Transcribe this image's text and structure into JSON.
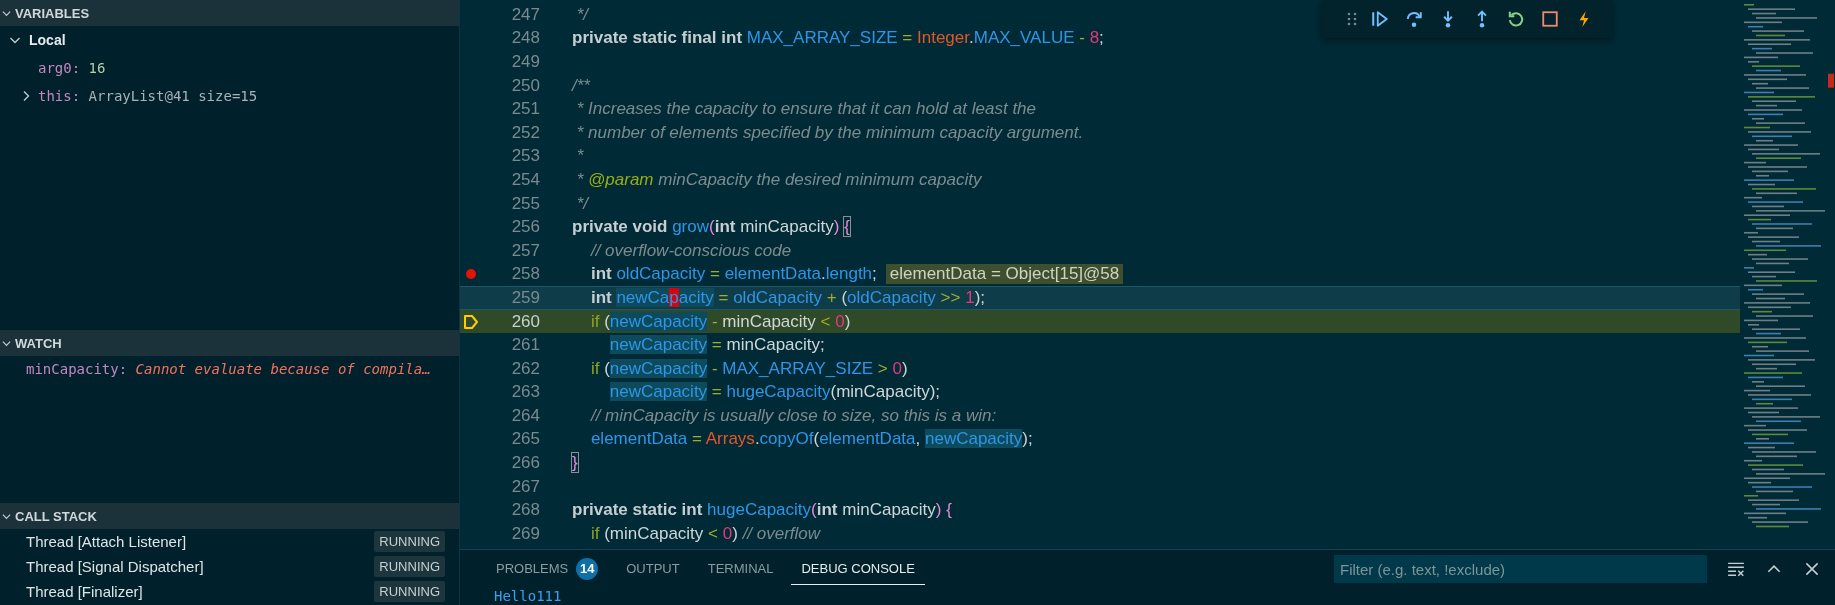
{
  "sidebar": {
    "variables": {
      "title": "VARIABLES",
      "expanded": true,
      "scopes": [
        {
          "name": "Local",
          "expanded": true,
          "children": [
            {
              "name": "arg0:",
              "value": "16",
              "kind": "number"
            },
            {
              "name": "this:",
              "value": "ArrayList@41 size=15",
              "kind": "object",
              "expanded": false
            }
          ]
        }
      ]
    },
    "watch": {
      "title": "WATCH",
      "expanded": true,
      "items": [
        {
          "name": "minCapacity:",
          "value": "Cannot evaluate because of compila…",
          "kind": "error"
        }
      ]
    },
    "call_stack": {
      "title": "CALL STACK",
      "expanded": true,
      "threads": [
        {
          "name": "Thread [Attach Listener]",
          "status": "RUNNING"
        },
        {
          "name": "Thread [Signal Dispatcher]",
          "status": "RUNNING"
        },
        {
          "name": "Thread [Finalizer]",
          "status": "RUNNING"
        }
      ]
    }
  },
  "editor": {
    "lines": [
      {
        "number": "247",
        "breakpoint": false,
        "paused": false,
        "focused": false,
        "tokens": [
          {
            "text": " */",
            "kind": "cm"
          }
        ]
      },
      {
        "number": "248",
        "breakpoint": false,
        "paused": false,
        "focused": false,
        "tokens": [
          {
            "text": "private static final int ",
            "kind": "kw"
          },
          {
            "text": "MAX_ARRAY_SIZE",
            "kind": "var"
          },
          {
            "text": " = ",
            "kind": "op"
          },
          {
            "text": "Integer",
            "kind": "cls"
          },
          {
            "text": ".",
            "kind": "plain"
          },
          {
            "text": "MAX_VALUE",
            "kind": "var"
          },
          {
            "text": " - ",
            "kind": "op"
          },
          {
            "text": "8",
            "kind": "num"
          },
          {
            "text": ";",
            "kind": "plain"
          }
        ]
      },
      {
        "number": "249",
        "breakpoint": false,
        "paused": false,
        "focused": false
      },
      {
        "number": "250",
        "breakpoint": false,
        "paused": false,
        "focused": false,
        "tokens": [
          {
            "text": "/**",
            "kind": "cm"
          }
        ]
      },
      {
        "number": "251",
        "breakpoint": false,
        "paused": false,
        "focused": false,
        "tokens": [
          {
            "text": " * Increases the capacity to ensure that it can hold at least the",
            "kind": "cm"
          }
        ]
      },
      {
        "number": "252",
        "breakpoint": false,
        "paused": false,
        "focused": false,
        "tokens": [
          {
            "text": " * number of elements specified by the minimum capacity argument.",
            "kind": "cm"
          }
        ]
      },
      {
        "number": "253",
        "breakpoint": false,
        "paused": false,
        "focused": false,
        "tokens": [
          {
            "text": " *",
            "kind": "cm"
          }
        ]
      },
      {
        "number": "254",
        "breakpoint": false,
        "paused": false,
        "focused": false,
        "tokens": [
          {
            "text": " * ",
            "kind": "cm"
          },
          {
            "text": "@param",
            "kind": "doctag"
          },
          {
            "text": " minCapacity the desired minimum capacity",
            "kind": "cm"
          }
        ]
      },
      {
        "number": "255",
        "breakpoint": false,
        "paused": false,
        "focused": false,
        "tokens": [
          {
            "text": " */",
            "kind": "cm"
          }
        ]
      },
      {
        "number": "256",
        "breakpoint": false,
        "paused": false,
        "focused": false,
        "tokens": [
          {
            "text": "private void ",
            "kind": "kw"
          },
          {
            "text": "grow",
            "kind": "fn"
          },
          {
            "text": "(",
            "kind": "bracket"
          },
          {
            "text": "int",
            "kind": "kw"
          },
          {
            "text": " minCapacity",
            "kind": "plain"
          },
          {
            "text": ") ",
            "kind": "bracket"
          },
          {
            "text": "{",
            "kind": "match"
          }
        ]
      },
      {
        "number": "257",
        "breakpoint": false,
        "paused": false,
        "focused": false,
        "tokens": [
          {
            "text": "    // overflow-conscious code",
            "kind": "cm"
          }
        ]
      },
      {
        "number": "258",
        "breakpoint": true,
        "paused": false,
        "focused": false,
        "inline_value": "elementData = Object[15]@58",
        "tokens": [
          {
            "text": "    int ",
            "kind": "kw"
          },
          {
            "text": "oldCapacity",
            "kind": "var"
          },
          {
            "text": " = ",
            "kind": "op"
          },
          {
            "text": "elementData",
            "kind": "var"
          },
          {
            "text": ".",
            "kind": "plain"
          },
          {
            "text": "length",
            "kind": "var"
          },
          {
            "text": ";",
            "kind": "plain"
          }
        ]
      },
      {
        "number": "259",
        "breakpoint": false,
        "paused": false,
        "focused": true,
        "tokens": [
          {
            "text": "    int ",
            "kind": "kw"
          },
          {
            "text": "newCa",
            "kind": "var-hl"
          },
          {
            "text": "p",
            "kind": "caret"
          },
          {
            "text": "acity",
            "kind": "var-hl"
          },
          {
            "text": " = ",
            "kind": "op"
          },
          {
            "text": "oldCapacity",
            "kind": "var"
          },
          {
            "text": " + ",
            "kind": "op"
          },
          {
            "text": "(",
            "kind": "plain"
          },
          {
            "text": "oldCapacity",
            "kind": "var"
          },
          {
            "text": " >> ",
            "kind": "op"
          },
          {
            "text": "1",
            "kind": "num"
          },
          {
            "text": ");",
            "kind": "plain"
          }
        ]
      },
      {
        "number": "260",
        "breakpoint": false,
        "paused": true,
        "focused": false,
        "tokens": [
          {
            "text": "    if",
            "kind": "ctrl"
          },
          {
            "text": " (",
            "kind": "plain"
          },
          {
            "text": "newCapacity",
            "kind": "var-hl"
          },
          {
            "text": " - ",
            "kind": "op"
          },
          {
            "text": "minCapacity",
            "kind": "plain"
          },
          {
            "text": " < ",
            "kind": "op"
          },
          {
            "text": "0",
            "kind": "num"
          },
          {
            "text": ")",
            "kind": "plain"
          }
        ]
      },
      {
        "number": "261",
        "breakpoint": false,
        "paused": false,
        "focused": false,
        "tokens": [
          {
            "text": "        newCapacity",
            "kind": "var-hl"
          },
          {
            "text": " = ",
            "kind": "op"
          },
          {
            "text": "minCapacity;",
            "kind": "plain"
          }
        ]
      },
      {
        "number": "262",
        "breakpoint": false,
        "paused": false,
        "focused": false,
        "tokens": [
          {
            "text": "    if",
            "kind": "ctrl"
          },
          {
            "text": " (",
            "kind": "plain"
          },
          {
            "text": "newCapacity",
            "kind": "var-hl"
          },
          {
            "text": " - ",
            "kind": "op"
          },
          {
            "text": "MAX_ARRAY_SIZE",
            "kind": "var"
          },
          {
            "text": " > ",
            "kind": "op"
          },
          {
            "text": "0",
            "kind": "num"
          },
          {
            "text": ")",
            "kind": "plain"
          }
        ]
      },
      {
        "number": "263",
        "breakpoint": false,
        "paused": false,
        "focused": false,
        "tokens": [
          {
            "text": "        newCapacity",
            "kind": "var-hl"
          },
          {
            "text": " = ",
            "kind": "op"
          },
          {
            "text": "hugeCapacity",
            "kind": "fn"
          },
          {
            "text": "(minCapacity);",
            "kind": "plain"
          }
        ]
      },
      {
        "number": "264",
        "breakpoint": false,
        "paused": false,
        "focused": false,
        "tokens": [
          {
            "text": "    // minCapacity is usually close to size, so this is a win:",
            "kind": "cm"
          }
        ]
      },
      {
        "number": "265",
        "breakpoint": false,
        "paused": false,
        "focused": false,
        "tokens": [
          {
            "text": "    elementData",
            "kind": "var"
          },
          {
            "text": " = ",
            "kind": "op"
          },
          {
            "text": "Arrays",
            "kind": "cls"
          },
          {
            "text": ".",
            "kind": "plain"
          },
          {
            "text": "copyOf",
            "kind": "fn"
          },
          {
            "text": "(",
            "kind": "plain"
          },
          {
            "text": "elementData",
            "kind": "var"
          },
          {
            "text": ", ",
            "kind": "plain"
          },
          {
            "text": "newCapacity",
            "kind": "var-hl"
          },
          {
            "text": ");",
            "kind": "plain"
          }
        ]
      },
      {
        "number": "266",
        "breakpoint": false,
        "paused": false,
        "focused": false,
        "tokens": [
          {
            "text": "}",
            "kind": "match"
          }
        ]
      },
      {
        "number": "267",
        "breakpoint": false,
        "paused": false,
        "focused": false
      },
      {
        "number": "268",
        "breakpoint": false,
        "paused": false,
        "focused": false,
        "tokens": [
          {
            "text": "private static int ",
            "kind": "kw"
          },
          {
            "text": "hugeCapacity",
            "kind": "fn"
          },
          {
            "text": "(",
            "kind": "bracket"
          },
          {
            "text": "int",
            "kind": "kw"
          },
          {
            "text": " minCapacity",
            "kind": "plain"
          },
          {
            "text": ")",
            "kind": "bracket"
          },
          {
            "text": " {",
            "kind": "bracket"
          }
        ]
      },
      {
        "number": "269",
        "breakpoint": false,
        "paused": false,
        "focused": false,
        "tokens": [
          {
            "text": "    if",
            "kind": "ctrl"
          },
          {
            "text": " (",
            "kind": "plain"
          },
          {
            "text": "minCapacity",
            "kind": "plain"
          },
          {
            "text": " < ",
            "kind": "op"
          },
          {
            "text": "0",
            "kind": "num"
          },
          {
            "text": ")",
            "kind": "plain"
          },
          {
            "text": " // overflow",
            "kind": "cm"
          }
        ]
      }
    ]
  },
  "panel": {
    "tabs": [
      {
        "label": "PROBLEMS",
        "badge": "14",
        "selected": false
      },
      {
        "label": "OUTPUT",
        "selected": false
      },
      {
        "label": "TERMINAL",
        "selected": false
      },
      {
        "label": "DEBUG CONSOLE",
        "selected": true
      }
    ],
    "filter": {
      "placeholder": "Filter (e.g. text, !exclude)"
    },
    "console_lines": [
      "Hello111"
    ]
  }
}
